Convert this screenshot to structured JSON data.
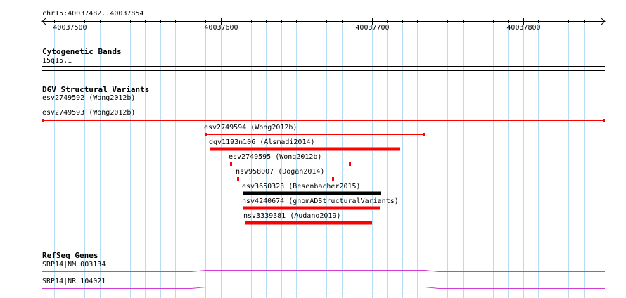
{
  "region_label": "chr15:40037482..40037854",
  "ruler": {
    "start": 40037482,
    "end": 40037854,
    "major_ticks": [
      {
        "pos": 40037500,
        "label": "40037500"
      },
      {
        "pos": 40037600,
        "label": "40037600"
      },
      {
        "pos": 40037700,
        "label": "40037700"
      },
      {
        "pos": 40037800,
        "label": "40037800"
      }
    ],
    "minor_step": 10
  },
  "colors": {
    "grid": "#b4dcf2",
    "variant_red": "#ff0000",
    "variant_black": "#000000",
    "gene_purple": "#d23cd2",
    "band_line": "#000000"
  },
  "tracks": {
    "cyto": {
      "title": "Cytogenetic Bands",
      "band_label": "15q15.1"
    },
    "dgv": {
      "title": "DGV Structural Variants",
      "features": [
        {
          "name": "esv2749592 (Wong2012b)",
          "start": 40037482,
          "end": 40037854,
          "style": "thin",
          "color": "#ff0000",
          "caps": false,
          "cont_right": true
        },
        {
          "name": "esv2749593 (Wong2012b)",
          "start": 40037482,
          "end": 40037854,
          "style": "thin",
          "color": "#ff0000",
          "caps": true
        },
        {
          "name": "esv2749594 (Wong2012b)",
          "start": 40037590,
          "end": 40037735,
          "style": "thin",
          "color": "#ff0000",
          "caps": true
        },
        {
          "name": "dgv1193n106 (Alsmadi2014)",
          "start": 40037593,
          "end": 40037718,
          "style": "thick",
          "color": "#ff0000"
        },
        {
          "name": "esv2749595 (Wong2012b)",
          "start": 40037606,
          "end": 40037686,
          "style": "thin",
          "color": "#ff0000",
          "caps": true
        },
        {
          "name": "nsv958007 (Dogan2014)",
          "start": 40037611,
          "end": 40037675,
          "style": "thin",
          "color": "#ff0000",
          "caps": true
        },
        {
          "name": "esv3650323 (Besenbacher2015)",
          "start": 40037615,
          "end": 40037706,
          "style": "thick",
          "color": "#000000"
        },
        {
          "name": "nsv4240674 (gnomADStructuralVariants)",
          "start": 40037615,
          "end": 40037705,
          "style": "thick",
          "color": "#ff0000"
        },
        {
          "name": "nsv3339381 (Audano2019)",
          "start": 40037616,
          "end": 40037700,
          "style": "thick",
          "color": "#ff0000"
        }
      ]
    },
    "refseq": {
      "title": "RefSeq Genes",
      "genes": [
        {
          "name": "SRP14|NM_003134"
        },
        {
          "name": "SRP14|NR_104021"
        }
      ]
    }
  }
}
